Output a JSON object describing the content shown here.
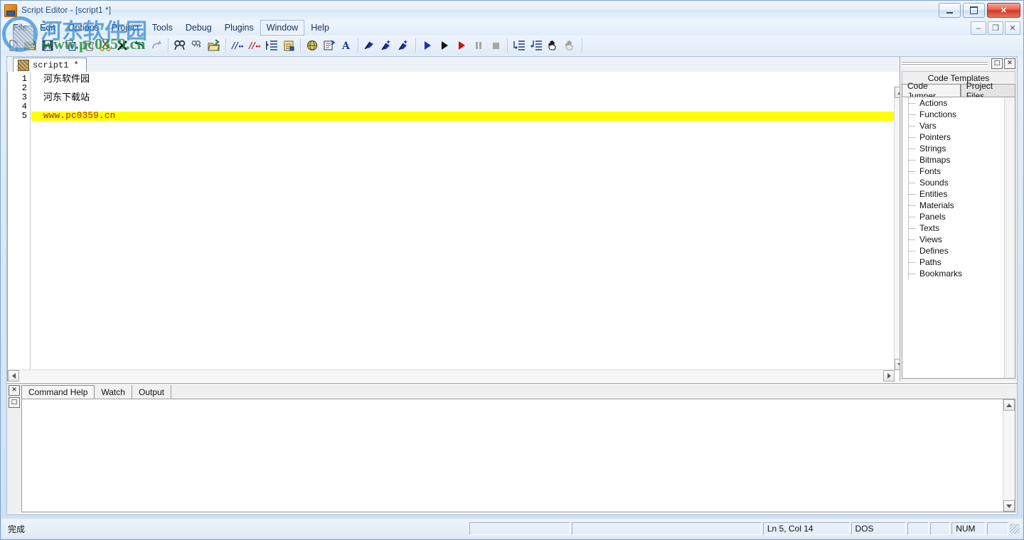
{
  "window": {
    "title": "Script Editor - [script1 *]",
    "icon": "script-app-icon",
    "controls": {
      "minimize": "",
      "maximize": "",
      "close": "✕"
    },
    "mdi_controls": {
      "minimize": "–",
      "restore": "❐",
      "close": "✕"
    }
  },
  "menu": {
    "items": [
      {
        "label": "File",
        "active": false
      },
      {
        "label": "Edit",
        "active": false
      },
      {
        "label": "Options",
        "active": false
      },
      {
        "label": "Project",
        "active": false
      },
      {
        "label": "Tools",
        "active": false
      },
      {
        "label": "Debug",
        "active": false
      },
      {
        "label": "Plugins",
        "active": false
      },
      {
        "label": "Window",
        "active": true
      },
      {
        "label": "Help",
        "active": false
      }
    ]
  },
  "toolbar": {
    "groups": [
      {
        "buttons": [
          {
            "name": "new-file-icon",
            "glyph": "new"
          },
          {
            "name": "open-file-icon",
            "glyph": "open"
          },
          {
            "name": "save-file-icon",
            "glyph": "save"
          }
        ]
      },
      {
        "buttons": [
          {
            "name": "copy-icon",
            "glyph": "copy"
          },
          {
            "name": "paste-icon",
            "glyph": "paste"
          },
          {
            "name": "cut-icon",
            "glyph": "cut"
          },
          {
            "name": "delete-icon",
            "glyph": "delete"
          },
          {
            "name": "undo-icon",
            "glyph": "undo"
          },
          {
            "name": "redo-icon",
            "glyph": "redo"
          }
        ]
      },
      {
        "buttons": [
          {
            "name": "find-icon",
            "glyph": "find"
          },
          {
            "name": "find-next-icon",
            "glyph": "findnext"
          },
          {
            "name": "open-include-icon",
            "glyph": "openinc"
          }
        ]
      },
      {
        "buttons": [
          {
            "name": "comment-block-icon",
            "glyph": "comment-blue"
          },
          {
            "name": "uncomment-block-icon",
            "glyph": "comment-red"
          },
          {
            "name": "indent-icon",
            "glyph": "indent"
          },
          {
            "name": "new-script-icon",
            "glyph": "newscript"
          }
        ]
      },
      {
        "buttons": [
          {
            "name": "globe-publish-icon",
            "glyph": "globe"
          },
          {
            "name": "properties-icon",
            "glyph": "properties"
          },
          {
            "name": "font-icon",
            "glyph": "A"
          }
        ]
      },
      {
        "buttons": [
          {
            "name": "bookmark-toggle-icon",
            "glyph": "flag"
          },
          {
            "name": "bookmark-next-icon",
            "glyph": "flag-next"
          },
          {
            "name": "bookmark-prev-icon",
            "glyph": "flag-prev"
          }
        ]
      },
      {
        "buttons": [
          {
            "name": "run-icon",
            "glyph": "play-blue"
          },
          {
            "name": "run-step-icon",
            "glyph": "play-black"
          },
          {
            "name": "run-debug-icon",
            "glyph": "play-red"
          },
          {
            "name": "pause-icon",
            "glyph": "pause"
          },
          {
            "name": "stop-icon",
            "glyph": "stop"
          }
        ]
      },
      {
        "buttons": [
          {
            "name": "step-into-icon",
            "glyph": "step-into"
          },
          {
            "name": "step-over-icon",
            "glyph": "step-over"
          },
          {
            "name": "hand-grab-icon",
            "glyph": "hand"
          },
          {
            "name": "hand-disabled-icon",
            "glyph": "hand-off"
          }
        ]
      }
    ]
  },
  "editor": {
    "tab": {
      "label": "script1 *",
      "icon": "script-doc-icon"
    },
    "lines": [
      {
        "num": "1",
        "text": "河东软件园",
        "style": "cjk"
      },
      {
        "num": "2",
        "text": "",
        "style": "plain"
      },
      {
        "num": "3",
        "text": "河东下载站",
        "style": "cjk"
      },
      {
        "num": "4",
        "text": "",
        "style": "plain"
      },
      {
        "num": "5",
        "text": "www.pc0359.cn",
        "style": "url"
      }
    ]
  },
  "right_dock": {
    "grip_buttons": {
      "float": "□",
      "close": "✕"
    },
    "top_tab": "Code Templates",
    "tabs": [
      {
        "label": "Code Jumper",
        "active": true
      },
      {
        "label": "Project Files",
        "active": false
      }
    ],
    "tree": [
      {
        "label": "Actions"
      },
      {
        "label": "Functions"
      },
      {
        "label": "Vars"
      },
      {
        "label": "Pointers"
      },
      {
        "label": "Strings"
      },
      {
        "label": "Bitmaps"
      },
      {
        "label": "Fonts"
      },
      {
        "label": "Sounds"
      },
      {
        "label": "Entities"
      },
      {
        "label": "Materials"
      },
      {
        "label": "Panels"
      },
      {
        "label": "Texts"
      },
      {
        "label": "Views"
      },
      {
        "label": "Defines"
      },
      {
        "label": "Paths"
      },
      {
        "label": "Bookmarks"
      }
    ]
  },
  "bottom_dock": {
    "side_buttons": {
      "close": "✕",
      "maximize": "□"
    },
    "tabs": [
      {
        "label": "Command Help",
        "active": true
      },
      {
        "label": "Watch",
        "active": false
      },
      {
        "label": "Output",
        "active": false
      }
    ],
    "content": ""
  },
  "statusbar": {
    "message": "完成",
    "pane_blank_1": "",
    "pane_blank_2": "",
    "cursor": "Ln 5, Col 14",
    "line_ending": "DOS",
    "pane_blank_3": "",
    "pane_blank_4": "",
    "num_lock": "NUM",
    "pane_blank_5": ""
  },
  "watermark": {
    "site_name": "河东软件园",
    "url": "www.pc0359.cn",
    "logo": "circle-globe-logo"
  },
  "colors": {
    "titlebar_text": "#16477f",
    "highlight_bg": "#ffff00",
    "highlight_text": "#b41f1f",
    "watermark_blue": "#2f86d6",
    "watermark_green": "#1e8a36",
    "close_red": "#cf3a22"
  }
}
